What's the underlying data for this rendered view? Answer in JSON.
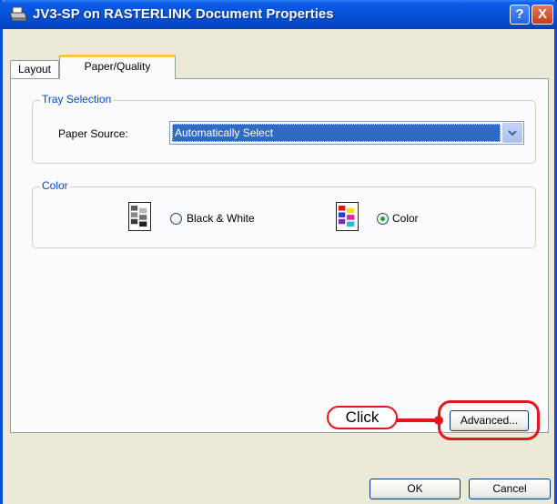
{
  "window": {
    "title": "JV3-SP on RASTERLINK Document Properties",
    "help_label": "?",
    "close_label": "X"
  },
  "tabs": [
    {
      "label": "Layout",
      "selected": false
    },
    {
      "label": "Paper/Quality",
      "selected": true
    }
  ],
  "tray_selection": {
    "group_label": "Tray Selection",
    "paper_source_label": "Paper Source:",
    "paper_source_value": "Automatically Select"
  },
  "color": {
    "group_label": "Color",
    "options": [
      {
        "label": "Black & White",
        "selected": false
      },
      {
        "label": "Color",
        "selected": true
      }
    ]
  },
  "buttons": {
    "advanced": "Advanced...",
    "ok": "OK",
    "cancel": "Cancel"
  },
  "annotation": {
    "label": "Click",
    "color": "#e8141b"
  }
}
